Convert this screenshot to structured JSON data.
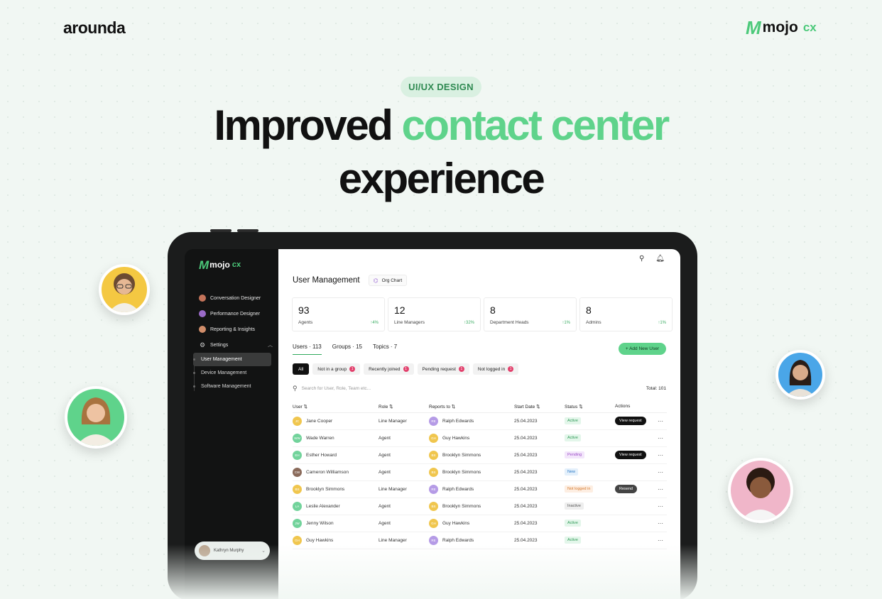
{
  "brand_left": "arounda",
  "brand_right": {
    "word": "mojo",
    "suffix": "cx"
  },
  "tag": "UI/UX DESIGN",
  "headline": {
    "line1_dark": "Improved",
    "line1_green": "contact center",
    "line2": "experience"
  },
  "colors": {
    "accent": "#5fd38b",
    "sidebar": "#121313"
  },
  "app": {
    "sidebar": {
      "logo_word": "mojo",
      "logo_suffix": "cx",
      "items": [
        {
          "label": "Conversation Designer",
          "icon": "avatar-dot"
        },
        {
          "label": "Performance Designer",
          "icon": "avatar-dot"
        },
        {
          "label": "Reporting & Insights",
          "icon": "avatar-dot"
        },
        {
          "label": "Settings",
          "icon": "gear-icon"
        }
      ],
      "sub_items": [
        {
          "label": "User Management",
          "active": true
        },
        {
          "label": "Device Management",
          "active": false
        },
        {
          "label": "Software Management",
          "active": false
        }
      ],
      "user": "Kathryn Murphy"
    },
    "title": "User Management",
    "org_chart_button": "Org Chart",
    "stats": [
      {
        "value": "93",
        "label": "Agents",
        "change": "↑4%"
      },
      {
        "value": "12",
        "label": "Line Managers",
        "change": "↑32%"
      },
      {
        "value": "8",
        "label": "Department Heads",
        "change": "↑1%"
      },
      {
        "value": "8",
        "label": "Admins",
        "change": "↑1%"
      }
    ],
    "tabs": [
      {
        "label": "Users · 113",
        "active": true
      },
      {
        "label": "Groups · 15",
        "active": false
      },
      {
        "label": "Topics · 7",
        "active": false
      }
    ],
    "add_button": "+ Add New User",
    "filters": [
      {
        "label": "All",
        "badge": ""
      },
      {
        "label": "Not in a group",
        "badge": "1"
      },
      {
        "label": "Recently joined",
        "badge": "1"
      },
      {
        "label": "Pending request",
        "badge": "1"
      },
      {
        "label": "Not logged in",
        "badge": "1"
      }
    ],
    "search_placeholder": "Search for User, Role, Team etc...",
    "total": "Total: 101",
    "columns": [
      "User",
      "Role",
      "Reports to",
      "Start Date",
      "Status",
      "Actions"
    ],
    "rows": [
      {
        "user": "Jane Cooper",
        "ini": "JC",
        "c": "#f0c64e",
        "role": "Line Manager",
        "rep": "Ralph Edwards",
        "rini": "RE",
        "rc": "#b59be6",
        "date": "25.04.2023",
        "status": "Active",
        "sk": "active",
        "action": "View request",
        "ak": ""
      },
      {
        "user": "Wade Warren",
        "ini": "WW",
        "c": "#72d39b",
        "role": "Agent",
        "rep": "Guy Hawkins",
        "rini": "GH",
        "rc": "#f0c64e",
        "date": "25.04.2023",
        "status": "Active",
        "sk": "active",
        "action": "",
        "ak": ""
      },
      {
        "user": "Esther Howard",
        "ini": "EH",
        "c": "#72d39b",
        "role": "Agent",
        "rep": "Brooklyn Simmons",
        "rini": "BS",
        "rc": "#f0c64e",
        "date": "25.04.2023",
        "status": "Pending",
        "sk": "pending",
        "action": "View request",
        "ak": ""
      },
      {
        "user": "Cameron Williamson",
        "ini": "CW",
        "c": "#8a6a5a",
        "role": "Agent",
        "rep": "Brooklyn Simmons",
        "rini": "BS",
        "rc": "#f0c64e",
        "date": "25.04.2023",
        "status": "New",
        "sk": "new",
        "action": "",
        "ak": ""
      },
      {
        "user": "Brooklyn Simmons",
        "ini": "BS",
        "c": "#f0c64e",
        "role": "Line Manager",
        "rep": "Ralph Edwards",
        "rini": "RE",
        "rc": "#b59be6",
        "date": "25.04.2023",
        "status": "Not logged in",
        "sk": "notlogged",
        "action": "Resend",
        "ak": "grey"
      },
      {
        "user": "Leslie Alexander",
        "ini": "LA",
        "c": "#72d39b",
        "role": "Agent",
        "rep": "Brooklyn Simmons",
        "rini": "BS",
        "rc": "#f0c64e",
        "date": "25.04.2023",
        "status": "Inactive",
        "sk": "inactive",
        "action": "",
        "ak": ""
      },
      {
        "user": "Jenny Wilson",
        "ini": "JW",
        "c": "#72d39b",
        "role": "Agent",
        "rep": "Guy Hawkins",
        "rini": "GH",
        "rc": "#f0c64e",
        "date": "25.04.2023",
        "status": "Active",
        "sk": "active",
        "action": "",
        "ak": ""
      },
      {
        "user": "Guy Hawkins",
        "ini": "GH",
        "c": "#f0c64e",
        "role": "Line Manager",
        "rep": "Ralph Edwards",
        "rini": "RE",
        "rc": "#b59be6",
        "date": "25.04.2023",
        "status": "Active",
        "sk": "active",
        "action": "",
        "ak": ""
      }
    ]
  }
}
